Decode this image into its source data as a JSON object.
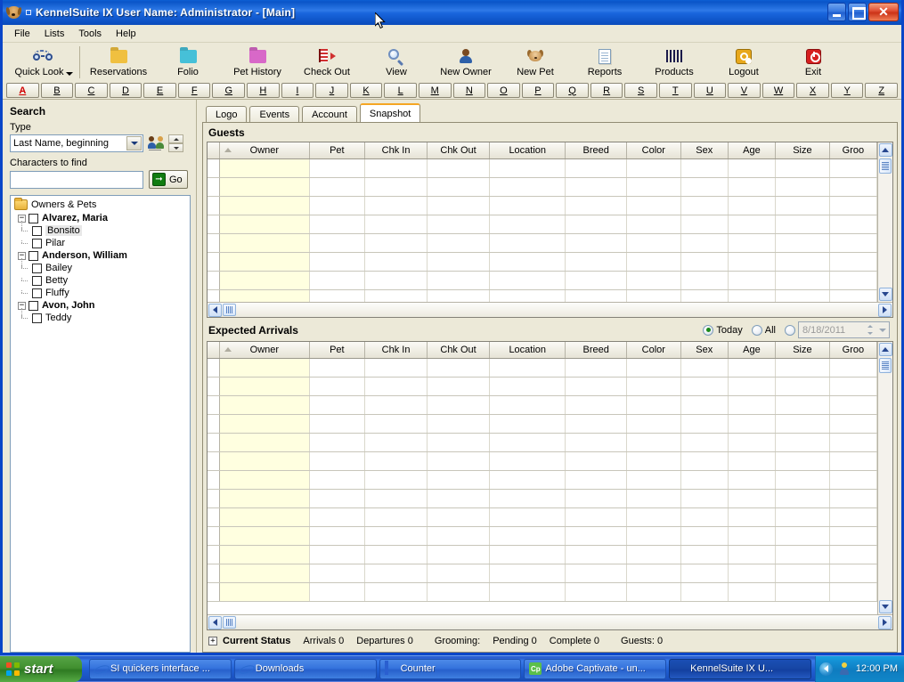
{
  "window": {
    "title": "KennelSuite IX   User Name: Administrator    - [Main]",
    "app_icon": "dog-icon",
    "minimize_label": "Minimize",
    "maximize_label": "Maximize",
    "close_label": "Close"
  },
  "menu": {
    "items": [
      {
        "label": "File"
      },
      {
        "label": "Lists"
      },
      {
        "label": "Tools"
      },
      {
        "label": "Help"
      }
    ]
  },
  "toolbar": {
    "buttons": [
      {
        "label": "Quick Look",
        "icon": "glasses-icon",
        "has_dropdown": true
      },
      {
        "label": "Reservations",
        "icon": "folder-yellow-icon"
      },
      {
        "label": "Folio",
        "icon": "folder-cyan-icon"
      },
      {
        "label": "Pet History",
        "icon": "folder-magenta-icon"
      },
      {
        "label": "Check Out",
        "icon": "checkout-icon"
      },
      {
        "label": "View",
        "icon": "magnifier-icon"
      },
      {
        "label": "New Owner",
        "icon": "person-icon"
      },
      {
        "label": "New Pet",
        "icon": "dog-head-icon"
      },
      {
        "label": "Reports",
        "icon": "document-icon"
      },
      {
        "label": "Products",
        "icon": "barcode-icon"
      },
      {
        "label": "Logout",
        "icon": "key-icon"
      },
      {
        "label": "Exit",
        "icon": "power-icon"
      }
    ]
  },
  "alphabar": {
    "active": "A",
    "letters": [
      "A",
      "B",
      "C",
      "D",
      "E",
      "F",
      "G",
      "H",
      "I",
      "J",
      "K",
      "L",
      "M",
      "N",
      "O",
      "P",
      "Q",
      "R",
      "S",
      "T",
      "U",
      "V",
      "W",
      "X",
      "Y",
      "Z"
    ]
  },
  "sidebar": {
    "heading": "Search",
    "type_label": "Type",
    "type_value": "Last Name, beginning",
    "find_label": "Characters to find",
    "find_value": "",
    "find_placeholder": "",
    "go_label": "Go",
    "tree_root": "Owners & Pets",
    "owners": [
      {
        "name": "Alvarez, Maria",
        "pets": [
          {
            "name": "Bonsito",
            "selected": true
          },
          {
            "name": "Pilar",
            "selected": false
          }
        ]
      },
      {
        "name": "Anderson, William",
        "pets": [
          {
            "name": "Bailey",
            "selected": false
          },
          {
            "name": "Betty",
            "selected": false
          },
          {
            "name": "Fluffy",
            "selected": false
          }
        ]
      },
      {
        "name": "Avon, John",
        "pets": [
          {
            "name": "Teddy",
            "selected": false
          }
        ]
      }
    ]
  },
  "tabs": {
    "items": [
      {
        "label": "Logo",
        "active": false
      },
      {
        "label": "Events",
        "active": false
      },
      {
        "label": "Account",
        "active": false
      },
      {
        "label": "Snapshot",
        "active": true
      }
    ],
    "active_accent": "#f5a623"
  },
  "guests": {
    "title": "Guests",
    "columns": [
      "Owner",
      "Pet",
      "Chk In",
      "Chk Out",
      "Location",
      "Breed",
      "Color",
      "Sex",
      "Age",
      "Size",
      "Groo"
    ],
    "sort_column": "Owner",
    "rows": [],
    "empty_row_count": 8,
    "owner_column_color": "#ffffe0"
  },
  "arrivals": {
    "title": "Expected Arrivals",
    "filters": [
      {
        "label": "Today",
        "selected": true
      },
      {
        "label": "All",
        "selected": false
      },
      {
        "label": "",
        "selected": false
      }
    ],
    "date_value": "8/18/2011",
    "date_enabled": false,
    "columns": [
      "Owner",
      "Pet",
      "Chk In",
      "Chk Out",
      "Location",
      "Breed",
      "Color",
      "Sex",
      "Age",
      "Size",
      "Groo"
    ],
    "sort_column": "Owner",
    "rows": [],
    "empty_row_count": 13,
    "owner_column_color": "#ffffe0"
  },
  "statusbar": {
    "expander": "+",
    "title": "Current Status",
    "items": [
      "Arrivals 0",
      "Departures 0",
      "Grooming:",
      "Pending 0",
      "Complete 0",
      "Guests: 0"
    ]
  },
  "taskbar": {
    "start_label": "start",
    "tasks": [
      {
        "label": "SI quickers interface ...",
        "icon": "ie-icon",
        "active": false
      },
      {
        "label": "Downloads",
        "icon": "ie-icon",
        "active": false
      },
      {
        "label": "Counter",
        "icon": "window-icon",
        "active": false
      },
      {
        "label": "Adobe Captivate - un...",
        "icon": "captivate-icon",
        "icon_text": "Cp",
        "active": false
      },
      {
        "label": "KennelSuite IX  U...",
        "icon": "dog-icon",
        "active": true
      }
    ],
    "tray": {
      "chevron": "show-hidden-icon",
      "icons": [
        "user-icon"
      ],
      "clock": "12:00 PM"
    }
  }
}
